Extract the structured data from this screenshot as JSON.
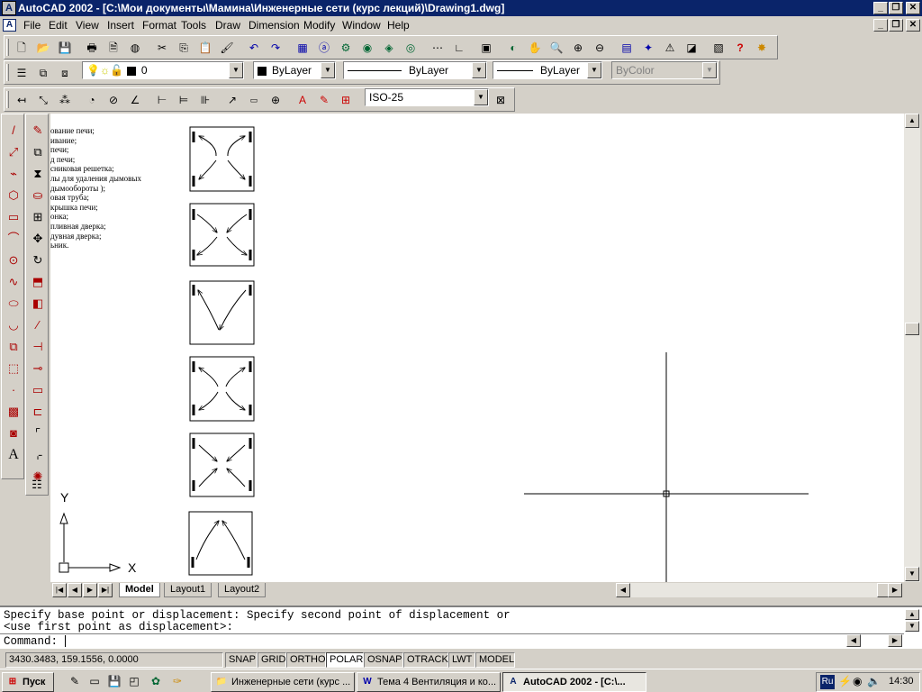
{
  "window": {
    "title": "AutoCAD 2002 - [C:\\Мои документы\\Мамина\\Инженерные сети (курс лекций)\\Drawing1.dwg]"
  },
  "menu": [
    "File",
    "Edit",
    "View",
    "Insert",
    "Format",
    "Tools",
    "Draw",
    "Dimension",
    "Modify",
    "Window",
    "Help"
  ],
  "layer_toolbar": {
    "layer": "0",
    "color": "ByLayer",
    "linetype": "ByLayer",
    "lineweight": "ByLayer",
    "plotstyle": "ByColor"
  },
  "dim_toolbar": {
    "dimstyle": "ISO-25"
  },
  "legend_lines": [
    "ование печи;",
    "ивание;",
    "печи;",
    "д печи;",
    "сниковая решетка;",
    "лы для удаления дымовых",
    "дымообороты );",
    "овая труба;",
    "крышка печи;",
    "онка;",
    "пливная дверка;",
    "дувная дверка;",
    "ьник."
  ],
  "ucs": {
    "y_label": "Y",
    "x_label": "X"
  },
  "tabs": [
    "Model",
    "Layout1",
    "Layout2"
  ],
  "command_lines": [
    "Specify base point or displacement: Specify second point of displacement or",
    "<use first point as displacement>:",
    "Command: "
  ],
  "status": {
    "coords": "3430.3483, 159.1556, 0.0000",
    "buttons": [
      "SNAP",
      "GRID",
      "ORTHO",
      "POLAR",
      "OSNAP",
      "OTRACK",
      "LWT",
      "MODEL"
    ]
  },
  "taskbar": {
    "start": "Пуск",
    "tasks": [
      "Инженерные сети (курс ...",
      "Тема 4 Вентиляция и ко...",
      "AutoCAD 2002 - [C:\\..."
    ],
    "tray_lang": "Ru",
    "clock": "14:30"
  },
  "colors": {
    "title_bg": "#0a246a",
    "face": "#d4d0c8",
    "canvas": "#ffffff"
  }
}
